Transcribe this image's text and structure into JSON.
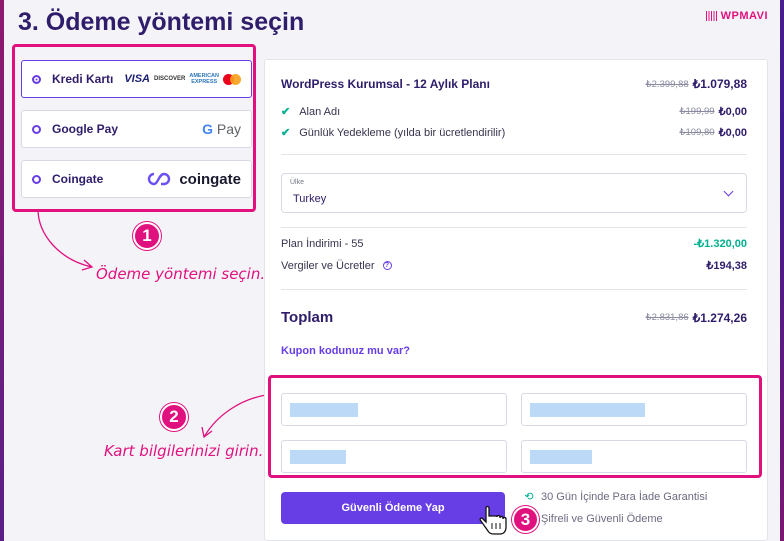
{
  "page_title": "3. Ödeme yöntemi seçin",
  "brand": "WPMAVI",
  "payment_methods": [
    {
      "label": "Kredi Kartı",
      "selected": true,
      "logos": [
        "VISA",
        "DISCOVER",
        "AMERICAN EXPRESS",
        "mastercard"
      ]
    },
    {
      "label": "Google Pay",
      "selected": false,
      "logo_text": "G Pay"
    },
    {
      "label": "Coingate",
      "selected": false,
      "logo_text": "coingate"
    }
  ],
  "logos": {
    "visa": "VISA",
    "discover": "DISCOVER",
    "amex_line1": "AMERICAN",
    "amex_line2": "EXPRESS",
    "gpay_g": "G",
    "gpay_text": "Pay",
    "coingate": "coingate"
  },
  "annotations": [
    {
      "number": "1",
      "text": "Ödeme yöntemi seçin."
    },
    {
      "number": "2",
      "text": "Kart bilgilerinizi girin."
    },
    {
      "number": "3",
      "text": ""
    }
  ],
  "summary": {
    "plan_name": "WordPress Kurumsal - 12 Aylık Planı",
    "plan_old_price": "₺2.399,88",
    "plan_price": "₺1.079,88",
    "features": [
      {
        "label": "Alan Adı",
        "old_price": "₺199,99",
        "price": "₺0,00"
      },
      {
        "label": "Günlük Yedekleme (yılda bir ücretlendirilir)",
        "old_price": "₺109,80",
        "price": "₺0,00"
      }
    ],
    "country_label": "Ülke",
    "country_value": "Turkey",
    "discount_label": "Plan İndirimi - 55",
    "discount_value": "-₺1.320,00",
    "tax_label": "Vergiler ve Ücretler",
    "tax_value": "₺194,38",
    "total_label": "Toplam",
    "total_old": "₺2.831,86",
    "total_value": "₺1.274,26",
    "coupon_link": "Kupon kodunuz mu var?"
  },
  "pay_button": "Güvenli Ödeme Yap",
  "guarantees": [
    "30 Gün İçinde Para İade Garantisi",
    "Şifreli ve Güvenli Ödeme"
  ],
  "colors": {
    "accent": "#673de6",
    "annotation": "#e0117f",
    "success": "#00b090",
    "heading": "#2f1c6a"
  }
}
